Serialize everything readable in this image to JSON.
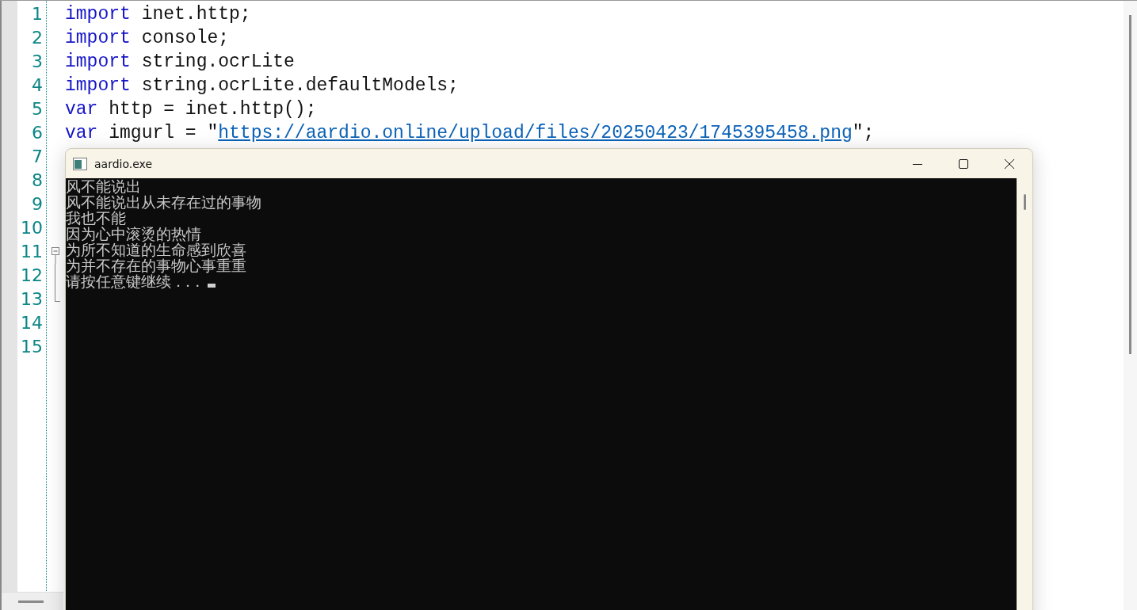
{
  "editor": {
    "lines": [
      {
        "number": "1",
        "tokens": [
          {
            "kind": "keyword",
            "text": "import"
          },
          {
            "kind": "plain",
            "text": " inet.http;"
          }
        ]
      },
      {
        "number": "2",
        "tokens": [
          {
            "kind": "keyword",
            "text": "import"
          },
          {
            "kind": "plain",
            "text": " console;"
          }
        ]
      },
      {
        "number": "3",
        "tokens": [
          {
            "kind": "keyword",
            "text": "import"
          },
          {
            "kind": "plain",
            "text": " string.ocrLite"
          }
        ]
      },
      {
        "number": "4",
        "tokens": [
          {
            "kind": "keyword",
            "text": "import"
          },
          {
            "kind": "plain",
            "text": " string.ocrLite.defaultModels;"
          }
        ]
      },
      {
        "number": "5",
        "tokens": [
          {
            "kind": "keyword",
            "text": "var"
          },
          {
            "kind": "plain",
            "text": " http = inet.http();"
          }
        ]
      },
      {
        "number": "6",
        "tokens": [
          {
            "kind": "keyword",
            "text": "var"
          },
          {
            "kind": "plain",
            "text": " imgurl = \""
          },
          {
            "kind": "link",
            "text": "https://aardio.online/upload/files/20250423/1745395458.png"
          },
          {
            "kind": "plain",
            "text": "\";"
          }
        ]
      },
      {
        "number": "7"
      },
      {
        "number": "8"
      },
      {
        "number": "9"
      },
      {
        "number": "10"
      },
      {
        "number": "11",
        "kind": "fold-start"
      },
      {
        "number": "12",
        "kind": "fold-body"
      },
      {
        "number": "13",
        "kind": "fold-end"
      },
      {
        "number": "14"
      },
      {
        "number": "15"
      }
    ]
  },
  "console": {
    "title": "aardio.exe",
    "lines": [
      {
        "text": "风不能说出"
      },
      {
        "text": "风不能说出从未存在过的事物"
      },
      {
        "text": "我也不能"
      },
      {
        "text": "因为心中滚烫的热情"
      },
      {
        "text": "为所不知道的生命感到欣喜"
      },
      {
        "text": "为并不存在的事物心事重重"
      },
      {
        "text": "请按任意键继续 . . .",
        "cursor": true
      }
    ]
  }
}
